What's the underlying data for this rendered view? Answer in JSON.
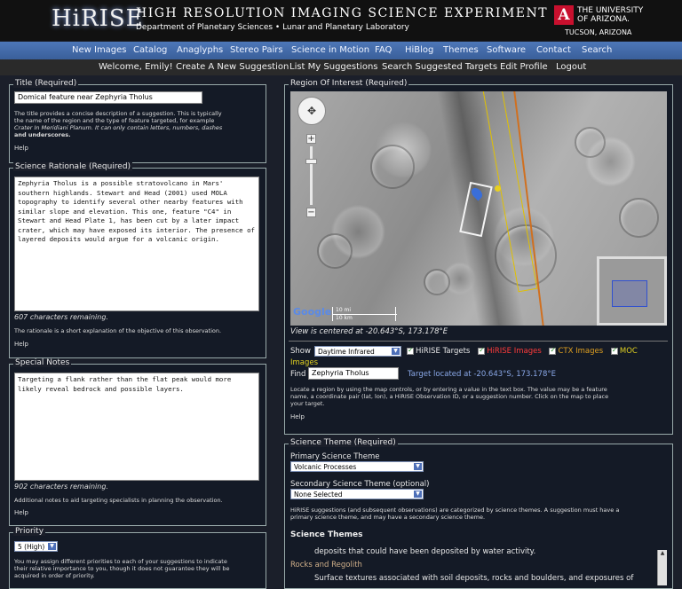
{
  "header": {
    "logo": "HiRISE",
    "title": "HIGH RESOLUTION IMAGING SCIENCE EXPERIMENT",
    "subtitle": "Department of Planetary Sciences • Lunar and Planetary Laboratory",
    "univ_mark": "A",
    "univ_line1": "THE UNIVERSITY",
    "univ_line2": "OF ARIZONA.",
    "univ_city": "TUCSON, ARIZONA"
  },
  "nav_main": [
    "New Images",
    "Catalog",
    "Anaglyphs",
    "Stereo Pairs",
    "Science in Motion",
    "FAQ",
    "HiBlog",
    "Themes",
    "Software",
    "Contact",
    "Search"
  ],
  "nav_user": [
    "Welcome, Emily!",
    "Create A New Suggestion",
    "List My Suggestions",
    "Search Suggested Targets",
    "Edit Profile",
    "Logout"
  ],
  "title_section": {
    "legend": "Title (Required)",
    "value": "Domical feature near Zephyria Tholus",
    "note_line1": "The title provides a concise description of a suggestion. This is typically",
    "note_line2": "the name of the region and the type of feature targeted, for example",
    "note_line3": "Crater In Meridiani Planum. It can only contain letters, numbers, dashes",
    "note_line4": "and underscores.",
    "help": "Help"
  },
  "rationale": {
    "legend": "Science Rationale (Required)",
    "text": "Zephyria Tholus is a possible stratovolcano in Mars' southern highlands.  Stewart and Head (2001) used MOLA topography to identify several other nearby features with similar slope and elevation. This one, feature \"C4\" in Stewart and Head Plate 1, has been cut by a later impact crater, which may have exposed its interior.  The presence of layered deposits would argue for a volcanic origin.",
    "remaining": "607 characters remaining.",
    "note": "The rationale is a short explanation of the objective of this observation.",
    "help": "Help"
  },
  "special_notes": {
    "legend": "Special Notes",
    "text": "Targeting a flank rather than the flat peak would more likely reveal bedrock and possible layers.",
    "remaining": "902 characters remaining.",
    "note": "Additional notes to aid targeting specialists in planning the observation.",
    "help": "Help"
  },
  "priority": {
    "legend": "Priority",
    "value": "5 (High)",
    "note_line1": "You may assign different priorities to each of your suggestions to indicate",
    "note_line2": "their relative importance to you, though it does not guarantee they will be",
    "note_line3": "acquired in order of priority."
  },
  "roi": {
    "legend": "Region Of Interest (Required)",
    "centered": "View is centered at -20.643°S, 173.178°E",
    "scale_top": "10 mi",
    "scale_bottom": "10 km",
    "google": "Google",
    "show_label": "Show",
    "show_value": "Daytime Infrared",
    "layer_hirise_targets": "HiRISE Targets",
    "layer_hirise_images": "HiRISE Images",
    "layer_ctx_images": "CTX Images",
    "layer_moc": "MOC",
    "layer_moc2": "Images",
    "find_label": "Find",
    "find_value": "Zephyria Tholus",
    "target_located": "Target located at -20.643°S, 173.178°E",
    "note_line1": "Locate a region by using the map controls, or by entering a value in the text box. The value may be a feature",
    "note_line2": "name, a coordinate pair (lat, lon), a HiRISE Observation ID, or a suggestion number. Click on the map to place",
    "note_line3": "your target.",
    "help": "Help",
    "colors": {
      "hirise_images": "#ff3b3b",
      "ctx_images": "#e0a020",
      "moc": "#e0d020"
    }
  },
  "theme": {
    "legend": "Science Theme (Required)",
    "primary_label": "Primary Science Theme",
    "primary_value": "Volcanic Processes",
    "secondary_label": "Secondary Science Theme (optional)",
    "secondary_value": "None Selected",
    "note_line1": "HiRISE suggestions (and subsequent observations) are categorized by science themes. A suggestion must have a",
    "note_line2": "primary science theme, and may have a secondary science theme.",
    "themes_heading": "Science Themes",
    "item1_desc": "deposits that could have been deposited by water activity.",
    "item2_title": "Rocks and Regolith",
    "item2_desc": "Surface textures associated with soil deposits, rocks and boulders, and exposures of"
  }
}
